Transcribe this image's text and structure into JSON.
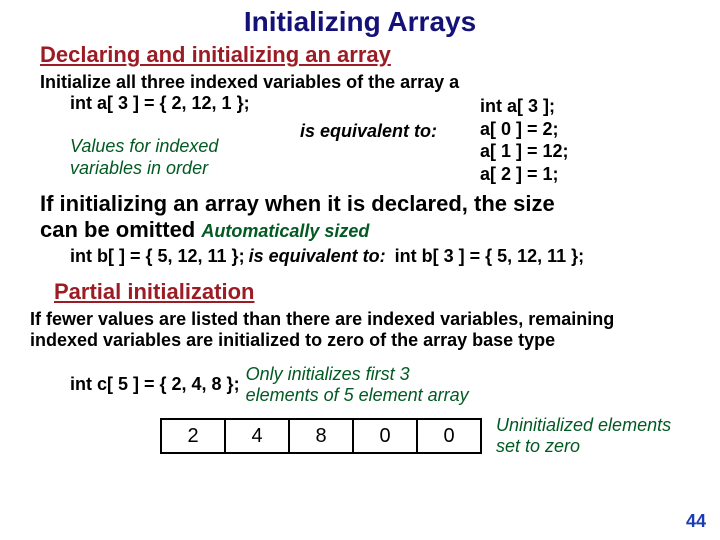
{
  "title": "Initializing Arrays",
  "section1_heading": "Declaring and initializing an array",
  "intro_line": "Initialize all three indexed variables of the array a",
  "example1_left_code": "int a[ 3 ] = { 2, 12, 1 };",
  "example1_left_note_l1": "Values for indexed",
  "example1_left_note_l2": "variables in order",
  "equiv_text": "is equivalent to:",
  "example1_right_l1": "int a[ 3 ];",
  "example1_right_l2": "a[ 0 ] = 2;",
  "example1_right_l3": "a[ 1 ] = 12;",
  "example1_right_l4": "a[ 2 ] = 1;",
  "para1_l1": "If initializing an array when it is declared, the size",
  "para1_l2_prefix": "can be omitted",
  "auto_sized": "Automatically sized",
  "example2_left": "int b[  ] = { 5, 12, 11 };",
  "example2_right": "int b[ 3 ] = { 5, 12, 11 };",
  "section2_heading": "Partial initialization",
  "para2": "If fewer values are listed than there are indexed variables, remaining indexed variables are initialized to zero of the array base type",
  "example3_code": "int c[ 5 ] = { 2, 4, 8 };",
  "example3_note_l1": "Only initializes first 3",
  "example3_note_l2": "elements of 5 element array",
  "cells": {
    "c0": "2",
    "c1": "4",
    "c2": "8",
    "c3": "0",
    "c4": "0"
  },
  "box_note_l1": "Uninitialized elements",
  "box_note_l2": "set to zero",
  "page_number": "44"
}
